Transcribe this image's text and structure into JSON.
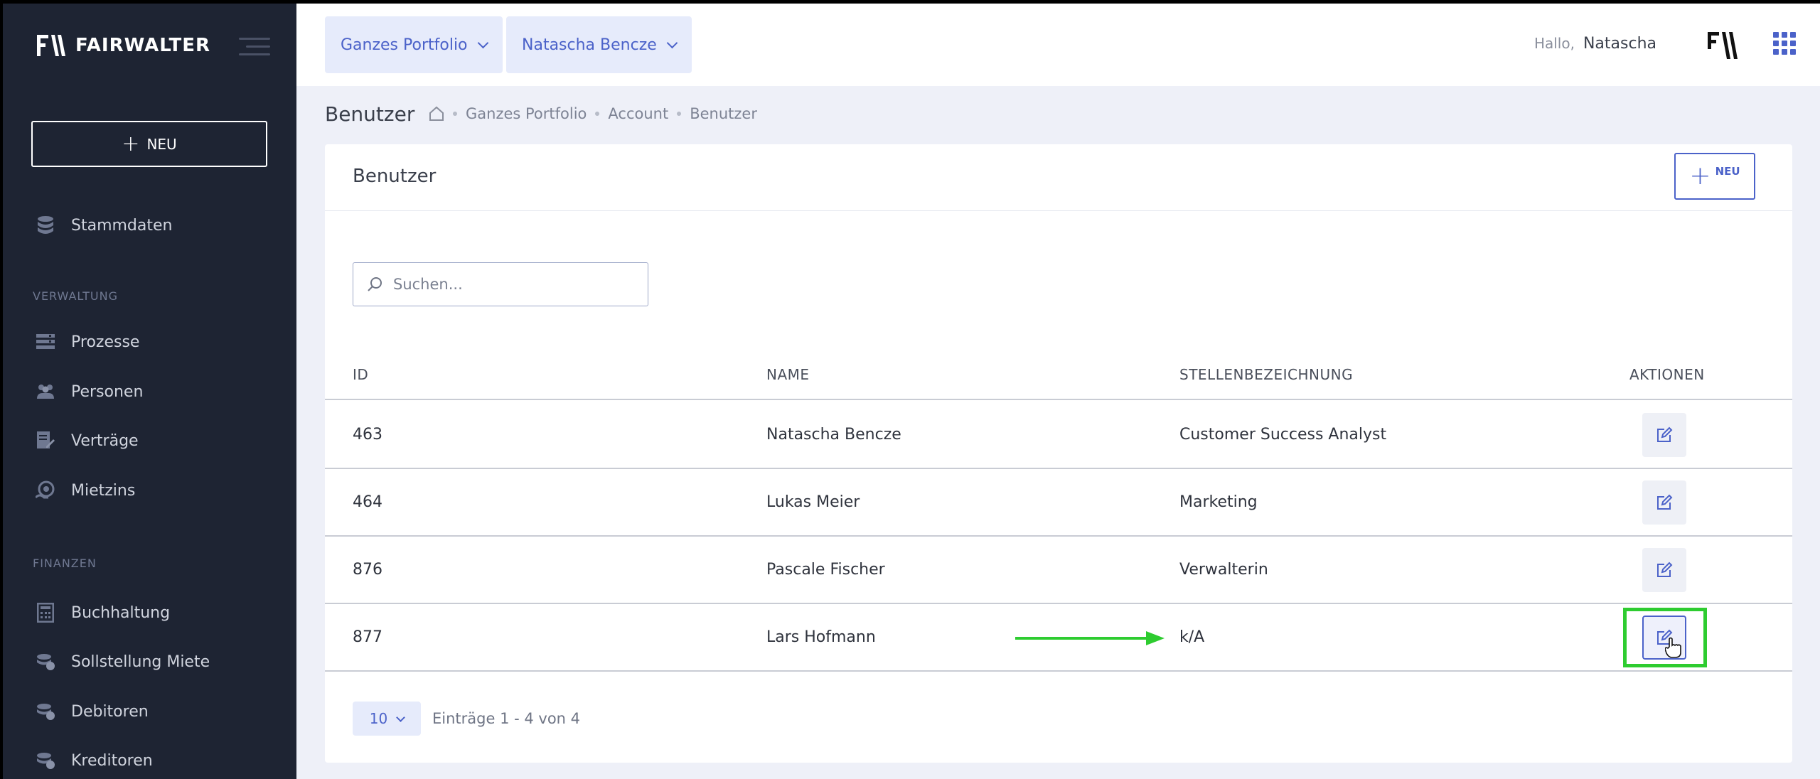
{
  "brand": {
    "name": "FAIRWALTER"
  },
  "sidebar": {
    "new_label": "NEU",
    "items_top": [
      {
        "label": "Stammdaten",
        "icon": "database-icon"
      }
    ],
    "sections": [
      {
        "label": "VERWALTUNG",
        "items": [
          {
            "label": "Prozesse",
            "icon": "process-icon"
          },
          {
            "label": "Personen",
            "icon": "people-icon"
          },
          {
            "label": "Verträge",
            "icon": "contract-icon"
          },
          {
            "label": "Mietzins",
            "icon": "rent-icon"
          }
        ]
      },
      {
        "label": "FINANZEN",
        "items": [
          {
            "label": "Buchhaltung",
            "icon": "calculator-icon"
          },
          {
            "label": "Sollstellung Miete",
            "icon": "coins-icon"
          },
          {
            "label": "Debitoren",
            "icon": "coins-icon"
          },
          {
            "label": "Kreditoren",
            "icon": "coins-icon"
          }
        ]
      }
    ]
  },
  "header": {
    "portfolio_select": "Ganzes Portfolio",
    "user_select": "Natascha Bencze",
    "greeting": "Hallo,",
    "user_name": "Natascha"
  },
  "page": {
    "title": "Benutzer",
    "breadcrumb": [
      "Ganzes Portfolio",
      "Account",
      "Benutzer"
    ]
  },
  "card": {
    "title": "Benutzer",
    "new_label": "NEU",
    "search_placeholder": "Suchen...",
    "columns": [
      "ID",
      "NAME",
      "STELLENBEZEICHNUNG",
      "AKTIONEN"
    ],
    "rows": [
      {
        "id": "463",
        "name": "Natascha Bencze",
        "title": "Customer Success Analyst"
      },
      {
        "id": "464",
        "name": "Lukas Meier",
        "title": "Marketing"
      },
      {
        "id": "876",
        "name": "Pascale Fischer",
        "title": "Verwalterin"
      },
      {
        "id": "877",
        "name": "Lars Hofmann",
        "title": "k/A"
      }
    ],
    "page_size": "10",
    "entries_text": "Einträge 1 - 4 von 4"
  },
  "colors": {
    "accent": "#4b62c9",
    "sidebar_bg": "#1e2433",
    "highlight": "#2ecc30"
  }
}
